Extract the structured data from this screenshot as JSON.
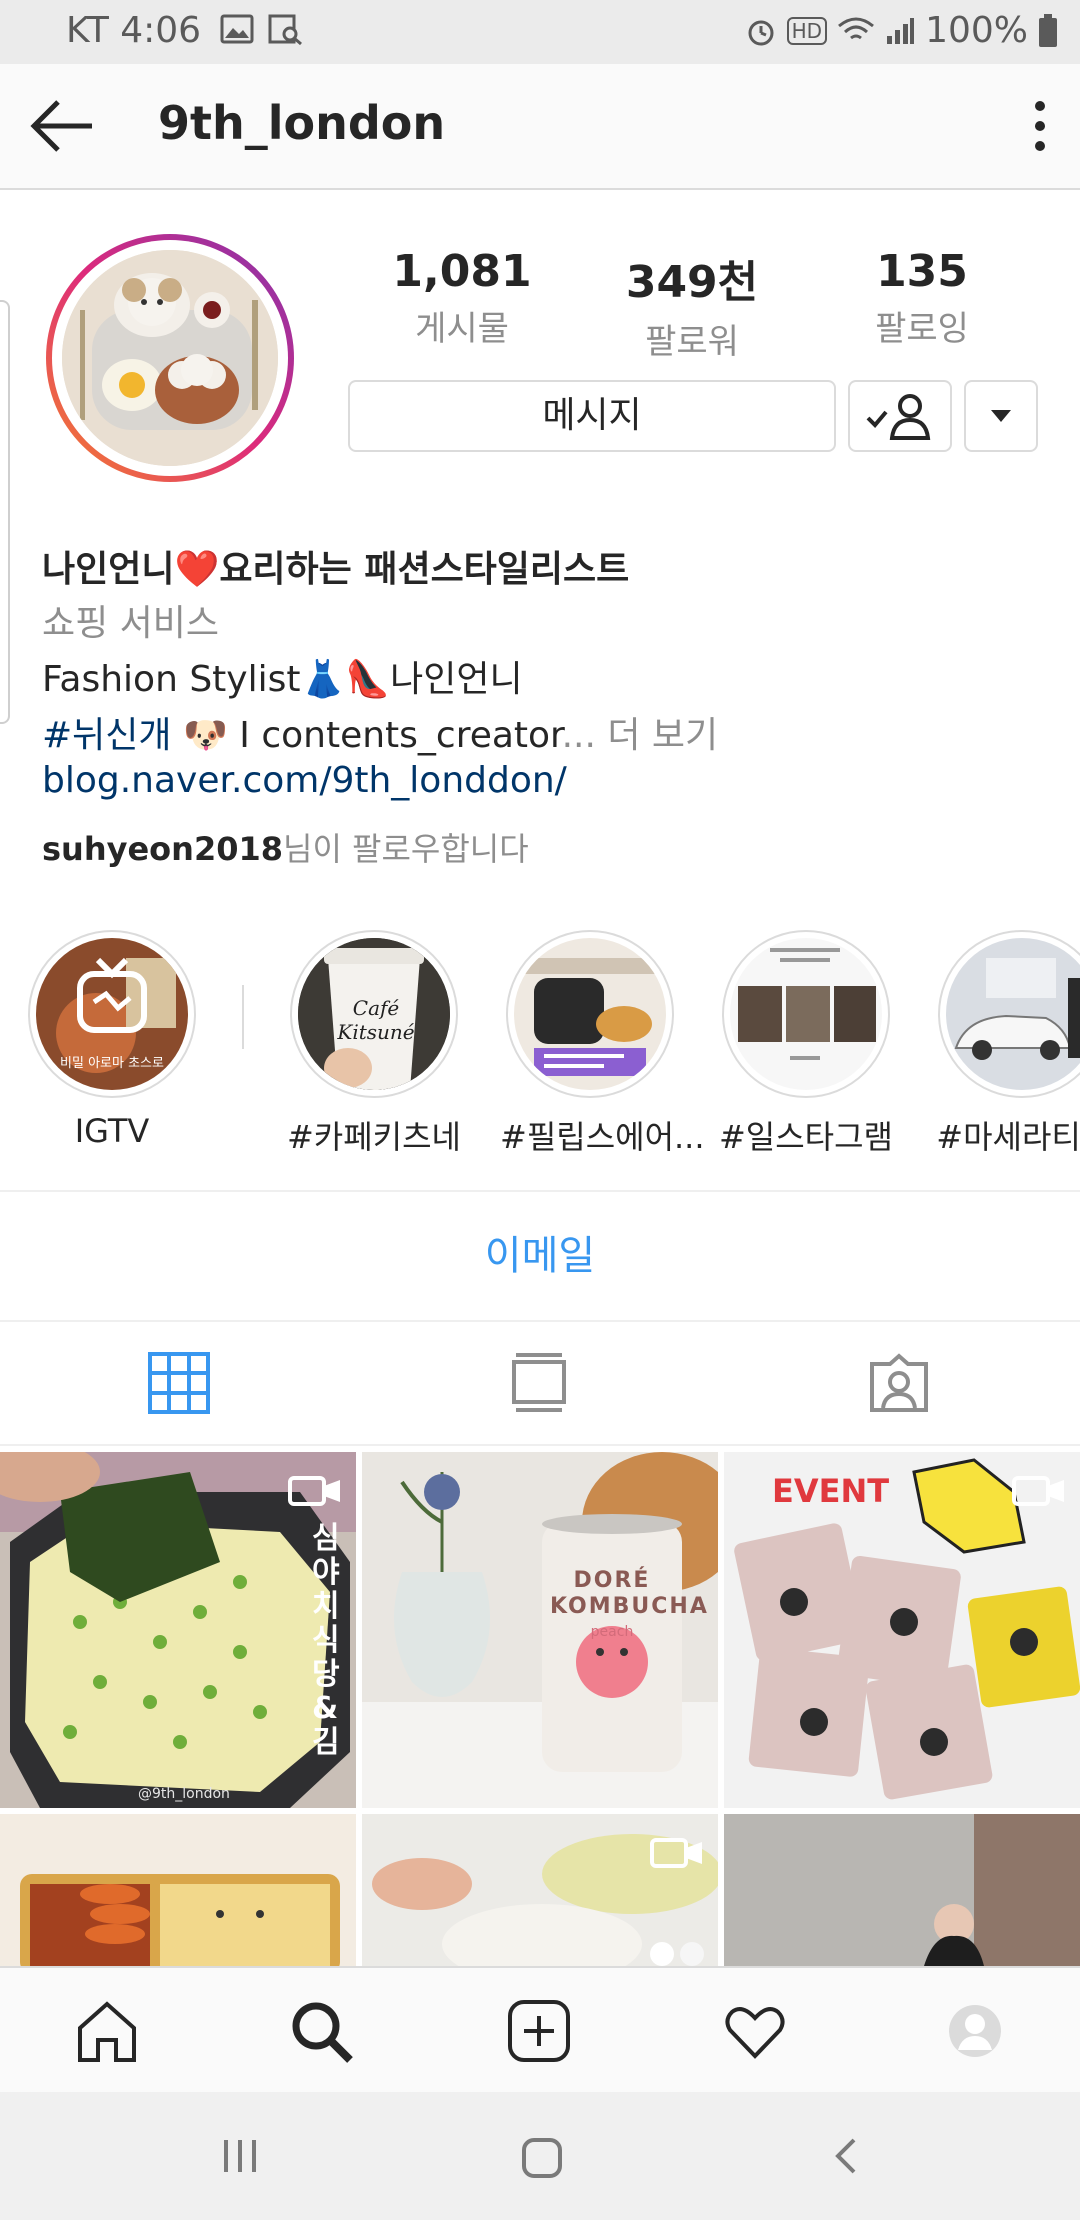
{
  "status_bar": {
    "carrier_time": "KT 4:06",
    "battery": "100%",
    "hd_label": "HD"
  },
  "header": {
    "username": "9th_london"
  },
  "profile": {
    "stats": [
      {
        "value": "1,081",
        "label": "게시물"
      },
      {
        "value": "349천",
        "label": "팔로워"
      },
      {
        "value": "135",
        "label": "팔로잉"
      }
    ],
    "message_label": "메시지"
  },
  "bio": {
    "name_part1": "나인언니",
    "name_emoji": "❤️",
    "name_part2": "요리하는 패션스타일리스트",
    "category": "쇼핑 서비스",
    "line1_text": "Fashion Stylist",
    "line1_emoji": "👗👠",
    "line1_suffix": "나인언니",
    "line2_hashtag": "#뉘신개",
    "line2_emoji": "🐶",
    "line2_text": " I contents_creator",
    "line2_more": "... 더 보기",
    "link": "blog.naver.com/9th_londdon/",
    "followed_user": "suhyeon2018",
    "followed_suffix": "님이 팔로우합니다"
  },
  "highlights": [
    {
      "label": "IGTV"
    },
    {
      "label": "#카페키츠네"
    },
    {
      "label": "#필립스에어..."
    },
    {
      "label": "#일스타그램"
    },
    {
      "label": "#마세라티#"
    }
  ],
  "highlight_texts": {
    "cafe": "Café Kitsuné",
    "igtv_caption": "비밀 아로마 초스로"
  },
  "contact": {
    "email_label": "이메일"
  },
  "posts_text": {
    "post1_caption": "심야치식당 &김",
    "post1_watermark": "@9th_london",
    "post2_can_brand": "DORÉ KOMBUCHA",
    "post2_can_flavor": "peach",
    "post3_event": "EVENT"
  },
  "colors": {
    "accent": "#3897f0",
    "link": "#003569",
    "muted": "#8e8e8e"
  }
}
